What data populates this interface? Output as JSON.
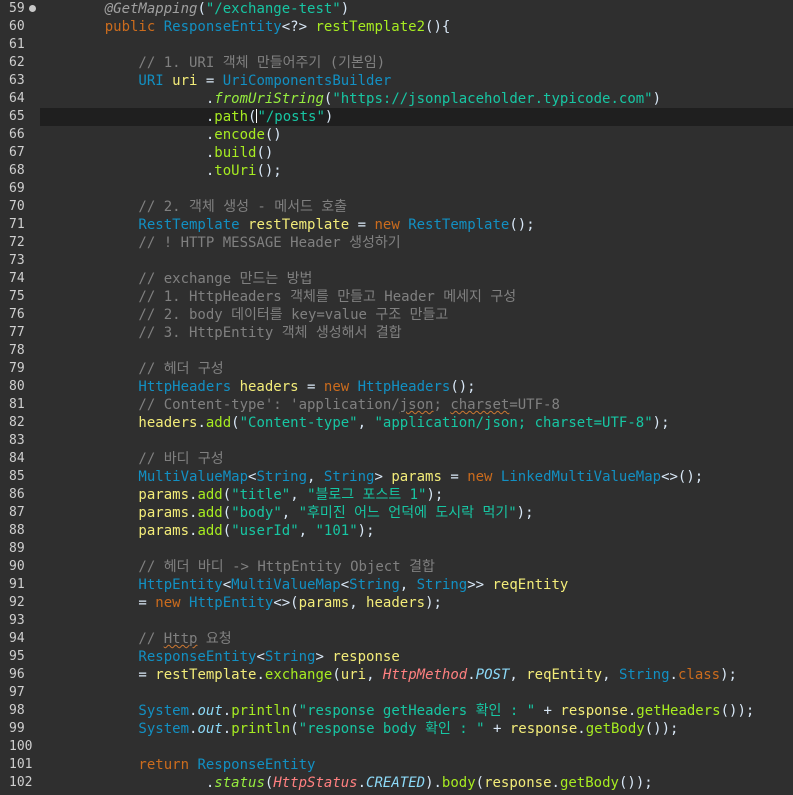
{
  "editor": {
    "current_line": 65,
    "lines": [
      {
        "num": 59,
        "fold": true,
        "tokens": [
          {
            "c": "ann",
            "t": "    @GetMapping"
          },
          {
            "c": "plain",
            "t": "("
          },
          {
            "c": "str",
            "t": "\"/exchange-test\""
          },
          {
            "c": "plain",
            "t": ")"
          }
        ]
      },
      {
        "num": 60,
        "tokens": [
          {
            "c": "kw",
            "t": "    public "
          },
          {
            "c": "type",
            "t": "ResponseEntity"
          },
          {
            "c": "plain",
            "t": "<?> "
          },
          {
            "c": "meth",
            "t": "restTemplate2"
          },
          {
            "c": "plain",
            "t": "(){"
          }
        ]
      },
      {
        "num": 61,
        "tokens": []
      },
      {
        "num": 62,
        "tokens": [
          {
            "c": "com",
            "t": "        // 1. URI 객체 만들어주기 (기본임)"
          }
        ]
      },
      {
        "num": 63,
        "tokens": [
          {
            "c": "type",
            "t": "        URI "
          },
          {
            "c": "var",
            "t": "uri"
          },
          {
            "c": "plain",
            "t": " = "
          },
          {
            "c": "type",
            "t": "UriComponentsBuilder"
          }
        ]
      },
      {
        "num": 64,
        "tokens": [
          {
            "c": "plain",
            "t": "                ."
          },
          {
            "c": "static",
            "t": "fromUriString"
          },
          {
            "c": "plain",
            "t": "("
          },
          {
            "c": "str",
            "t": "\"https://jsonplaceholder.typicode.com\""
          },
          {
            "c": "plain",
            "t": ")"
          }
        ]
      },
      {
        "num": 65,
        "current": true,
        "tokens": [
          {
            "c": "plain",
            "t": "                ."
          },
          {
            "c": "meth",
            "t": "path"
          },
          {
            "c": "plain",
            "t": "("
          },
          {
            "c": "caret",
            "t": ""
          },
          {
            "c": "str",
            "t": "\"/posts\""
          },
          {
            "c": "plain",
            "t": ")"
          }
        ]
      },
      {
        "num": 66,
        "tokens": [
          {
            "c": "plain",
            "t": "                ."
          },
          {
            "c": "meth",
            "t": "encode"
          },
          {
            "c": "plain",
            "t": "()"
          }
        ]
      },
      {
        "num": 67,
        "tokens": [
          {
            "c": "plain",
            "t": "                ."
          },
          {
            "c": "meth",
            "t": "build"
          },
          {
            "c": "plain",
            "t": "()"
          }
        ]
      },
      {
        "num": 68,
        "tokens": [
          {
            "c": "plain",
            "t": "                ."
          },
          {
            "c": "meth",
            "t": "toUri"
          },
          {
            "c": "plain",
            "t": "();"
          }
        ]
      },
      {
        "num": 69,
        "tokens": []
      },
      {
        "num": 70,
        "tokens": [
          {
            "c": "com",
            "t": "        // 2. 객체 생성 - 메서드 호출"
          }
        ]
      },
      {
        "num": 71,
        "tokens": [
          {
            "c": "type",
            "t": "        RestTemplate "
          },
          {
            "c": "var",
            "t": "restTemplate"
          },
          {
            "c": "plain",
            "t": " = "
          },
          {
            "c": "kw",
            "t": "new "
          },
          {
            "c": "type",
            "t": "RestTemplate"
          },
          {
            "c": "plain",
            "t": "();"
          }
        ]
      },
      {
        "num": 72,
        "tokens": [
          {
            "c": "com",
            "t": "        // ! HTTP MESSAGE Header 생성하기"
          }
        ]
      },
      {
        "num": 73,
        "tokens": []
      },
      {
        "num": 74,
        "tokens": [
          {
            "c": "com",
            "t": "        // exchange 만드는 방법"
          }
        ]
      },
      {
        "num": 75,
        "tokens": [
          {
            "c": "com",
            "t": "        // 1. HttpHeaders 객체를 만들고 Header 메세지 구성"
          }
        ]
      },
      {
        "num": 76,
        "tokens": [
          {
            "c": "com",
            "t": "        // 2. body 데이터를 key=value 구조 만들고"
          }
        ]
      },
      {
        "num": 77,
        "tokens": [
          {
            "c": "com",
            "t": "        // 3. HttpEntity 객체 생성해서 결합"
          }
        ]
      },
      {
        "num": 78,
        "tokens": []
      },
      {
        "num": 79,
        "tokens": [
          {
            "c": "com",
            "t": "        // 헤더 구성"
          }
        ]
      },
      {
        "num": 80,
        "tokens": [
          {
            "c": "type",
            "t": "        HttpHeaders "
          },
          {
            "c": "var",
            "t": "headers"
          },
          {
            "c": "plain",
            "t": " = "
          },
          {
            "c": "kw",
            "t": "new "
          },
          {
            "c": "type",
            "t": "HttpHeaders"
          },
          {
            "c": "plain",
            "t": "();"
          }
        ]
      },
      {
        "num": 81,
        "tokens": [
          {
            "c": "com",
            "t": "        // Content-type': 'application/"
          },
          {
            "c": "comwarn",
            "t": "json"
          },
          {
            "c": "com",
            "t": "; "
          },
          {
            "c": "comwarn",
            "t": "charset"
          },
          {
            "c": "com",
            "t": "=UTF-8"
          }
        ]
      },
      {
        "num": 82,
        "tokens": [
          {
            "c": "var",
            "t": "        headers"
          },
          {
            "c": "plain",
            "t": "."
          },
          {
            "c": "meth",
            "t": "add"
          },
          {
            "c": "plain",
            "t": "("
          },
          {
            "c": "str",
            "t": "\"Content-type\""
          },
          {
            "c": "plain",
            "t": ", "
          },
          {
            "c": "str",
            "t": "\"application/json; charset=UTF-8\""
          },
          {
            "c": "plain",
            "t": ");"
          }
        ]
      },
      {
        "num": 83,
        "tokens": []
      },
      {
        "num": 84,
        "tokens": [
          {
            "c": "com",
            "t": "        // 바디 구성"
          }
        ]
      },
      {
        "num": 85,
        "tokens": [
          {
            "c": "type",
            "t": "        MultiValueMap"
          },
          {
            "c": "plain",
            "t": "<"
          },
          {
            "c": "type",
            "t": "String"
          },
          {
            "c": "plain",
            "t": ", "
          },
          {
            "c": "type",
            "t": "String"
          },
          {
            "c": "plain",
            "t": "> "
          },
          {
            "c": "var",
            "t": "params"
          },
          {
            "c": "plain",
            "t": " = "
          },
          {
            "c": "kw",
            "t": "new "
          },
          {
            "c": "type",
            "t": "LinkedMultiValueMap"
          },
          {
            "c": "plain",
            "t": "<>();"
          }
        ]
      },
      {
        "num": 86,
        "tokens": [
          {
            "c": "var",
            "t": "        params"
          },
          {
            "c": "plain",
            "t": "."
          },
          {
            "c": "meth",
            "t": "add"
          },
          {
            "c": "plain",
            "t": "("
          },
          {
            "c": "str",
            "t": "\"title\""
          },
          {
            "c": "plain",
            "t": ", "
          },
          {
            "c": "str",
            "t": "\"블로그 포스트 1\""
          },
          {
            "c": "plain",
            "t": ");"
          }
        ]
      },
      {
        "num": 87,
        "tokens": [
          {
            "c": "var",
            "t": "        params"
          },
          {
            "c": "plain",
            "t": "."
          },
          {
            "c": "meth",
            "t": "add"
          },
          {
            "c": "plain",
            "t": "("
          },
          {
            "c": "str",
            "t": "\"body\""
          },
          {
            "c": "plain",
            "t": ", "
          },
          {
            "c": "str",
            "t": "\"후미진 어느 언덕에 도시락 먹기\""
          },
          {
            "c": "plain",
            "t": ");"
          }
        ]
      },
      {
        "num": 88,
        "tokens": [
          {
            "c": "var",
            "t": "        params"
          },
          {
            "c": "plain",
            "t": "."
          },
          {
            "c": "meth",
            "t": "add"
          },
          {
            "c": "plain",
            "t": "("
          },
          {
            "c": "str",
            "t": "\"userId\""
          },
          {
            "c": "plain",
            "t": ", "
          },
          {
            "c": "str",
            "t": "\"101\""
          },
          {
            "c": "plain",
            "t": ");"
          }
        ]
      },
      {
        "num": 89,
        "tokens": []
      },
      {
        "num": 90,
        "tokens": [
          {
            "c": "com",
            "t": "        // 헤더 바디 -> HttpEntity Object 결합"
          }
        ]
      },
      {
        "num": 91,
        "tokens": [
          {
            "c": "type",
            "t": "        HttpEntity"
          },
          {
            "c": "plain",
            "t": "<"
          },
          {
            "c": "type",
            "t": "MultiValueMap"
          },
          {
            "c": "plain",
            "t": "<"
          },
          {
            "c": "type",
            "t": "String"
          },
          {
            "c": "plain",
            "t": ", "
          },
          {
            "c": "type",
            "t": "String"
          },
          {
            "c": "plain",
            "t": ">> "
          },
          {
            "c": "var",
            "t": "reqEntity"
          }
        ]
      },
      {
        "num": 92,
        "tokens": [
          {
            "c": "plain",
            "t": "        = "
          },
          {
            "c": "kw",
            "t": "new "
          },
          {
            "c": "type",
            "t": "HttpEntity"
          },
          {
            "c": "plain",
            "t": "<>("
          },
          {
            "c": "var",
            "t": "params"
          },
          {
            "c": "plain",
            "t": ", "
          },
          {
            "c": "var",
            "t": "headers"
          },
          {
            "c": "plain",
            "t": ");"
          }
        ]
      },
      {
        "num": 93,
        "tokens": []
      },
      {
        "num": 94,
        "tokens": [
          {
            "c": "com",
            "t": "        // "
          },
          {
            "c": "comwarn",
            "t": "Http"
          },
          {
            "c": "com",
            "t": " 요청"
          }
        ]
      },
      {
        "num": 95,
        "tokens": [
          {
            "c": "type",
            "t": "        ResponseEntity"
          },
          {
            "c": "plain",
            "t": "<"
          },
          {
            "c": "type",
            "t": "String"
          },
          {
            "c": "plain",
            "t": "> "
          },
          {
            "c": "var",
            "t": "response"
          }
        ]
      },
      {
        "num": 96,
        "tokens": [
          {
            "c": "plain",
            "t": "        = "
          },
          {
            "c": "var",
            "t": "restTemplate"
          },
          {
            "c": "plain",
            "t": "."
          },
          {
            "c": "meth",
            "t": "exchange"
          },
          {
            "c": "plain",
            "t": "("
          },
          {
            "c": "var",
            "t": "uri"
          },
          {
            "c": "plain",
            "t": ", "
          },
          {
            "c": "enumtype",
            "t": "HttpMethod"
          },
          {
            "c": "plain",
            "t": "."
          },
          {
            "c": "const",
            "t": "POST"
          },
          {
            "c": "plain",
            "t": ", "
          },
          {
            "c": "var",
            "t": "reqEntity"
          },
          {
            "c": "plain",
            "t": ", "
          },
          {
            "c": "type",
            "t": "String"
          },
          {
            "c": "plain",
            "t": "."
          },
          {
            "c": "kw",
            "t": "class"
          },
          {
            "c": "plain",
            "t": ");"
          }
        ]
      },
      {
        "num": 97,
        "tokens": []
      },
      {
        "num": 98,
        "tokens": [
          {
            "c": "type",
            "t": "        System"
          },
          {
            "c": "plain",
            "t": "."
          },
          {
            "c": "field",
            "t": "out"
          },
          {
            "c": "plain",
            "t": "."
          },
          {
            "c": "meth",
            "t": "println"
          },
          {
            "c": "plain",
            "t": "("
          },
          {
            "c": "str",
            "t": "\"response getHeaders 확인 : \""
          },
          {
            "c": "plain",
            "t": " + "
          },
          {
            "c": "var",
            "t": "response"
          },
          {
            "c": "plain",
            "t": "."
          },
          {
            "c": "meth",
            "t": "getHeaders"
          },
          {
            "c": "plain",
            "t": "());"
          }
        ]
      },
      {
        "num": 99,
        "tokens": [
          {
            "c": "type",
            "t": "        System"
          },
          {
            "c": "plain",
            "t": "."
          },
          {
            "c": "field",
            "t": "out"
          },
          {
            "c": "plain",
            "t": "."
          },
          {
            "c": "meth",
            "t": "println"
          },
          {
            "c": "plain",
            "t": "("
          },
          {
            "c": "str",
            "t": "\"response body 확인 : \""
          },
          {
            "c": "plain",
            "t": " + "
          },
          {
            "c": "var",
            "t": "response"
          },
          {
            "c": "plain",
            "t": "."
          },
          {
            "c": "meth",
            "t": "getBody"
          },
          {
            "c": "plain",
            "t": "());"
          }
        ]
      },
      {
        "num": 100,
        "tokens": []
      },
      {
        "num": 101,
        "tokens": [
          {
            "c": "kw",
            "t": "        return "
          },
          {
            "c": "type",
            "t": "ResponseEntity"
          }
        ]
      },
      {
        "num": 102,
        "tokens": [
          {
            "c": "plain",
            "t": "                ."
          },
          {
            "c": "static",
            "t": "status"
          },
          {
            "c": "plain",
            "t": "("
          },
          {
            "c": "enumtype",
            "t": "HttpStatus"
          },
          {
            "c": "plain",
            "t": "."
          },
          {
            "c": "const",
            "t": "CREATED"
          },
          {
            "c": "plain",
            "t": ")."
          },
          {
            "c": "meth",
            "t": "body"
          },
          {
            "c": "plain",
            "t": "("
          },
          {
            "c": "var",
            "t": "response"
          },
          {
            "c": "plain",
            "t": "."
          },
          {
            "c": "meth",
            "t": "getBody"
          },
          {
            "c": "plain",
            "t": "());"
          }
        ]
      }
    ]
  }
}
